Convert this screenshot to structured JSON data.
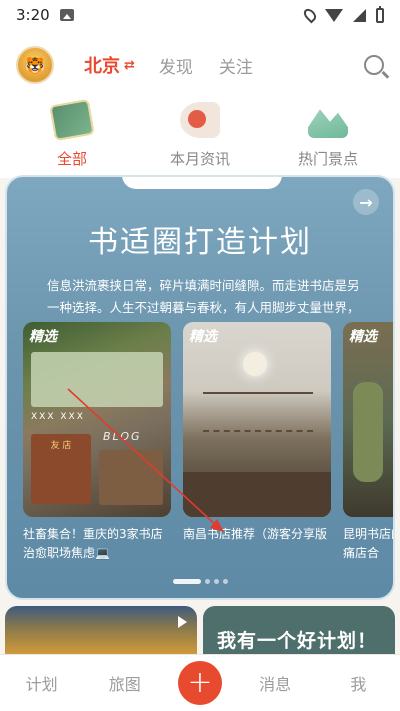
{
  "status_bar": {
    "time": "3:20"
  },
  "header": {
    "city": "北京",
    "city_switch_icon": "swap-icon",
    "tabs": [
      "发现",
      "关注"
    ]
  },
  "categories": [
    {
      "label": "全部",
      "active": true,
      "icon": "all-icon"
    },
    {
      "label": "本月资讯",
      "active": false,
      "icon": "megaphone-icon"
    },
    {
      "label": "热门景点",
      "active": false,
      "icon": "landscape-icon"
    }
  ],
  "feature_card": {
    "title": "书适圈打造计划",
    "description": "信息洪流裹挟日常，碎片填满时间缝隙。而走进书店是另一种选择。人生不过朝暮与春秋，有人用脚步丈量世界，我…",
    "posts": [
      {
        "tag": "精选",
        "caption": "社畜集合！重庆的3家书店治愈职场焦虑💻",
        "overlay_row": "XXX XXX",
        "overlay_blog": "BLOG",
        "overlay_bookstore": "友 店"
      },
      {
        "tag": "精选",
        "caption": "南昌书店推荐（游客分享版"
      },
      {
        "tag": "精选",
        "caption": "昆明书店的痛店合"
      }
    ],
    "dots": 5,
    "active_dot": 0
  },
  "bottom_cards": [
    {
      "label": ""
    },
    {
      "label": "我有一个好计划！"
    }
  ],
  "bottom_nav": {
    "items": [
      "计划",
      "旅图",
      "消息",
      "我"
    ],
    "center_label": "+"
  },
  "colors": {
    "accent": "#e84a2f",
    "card_bg": "#6c95ae",
    "inactive_text": "#9c9c9c"
  }
}
